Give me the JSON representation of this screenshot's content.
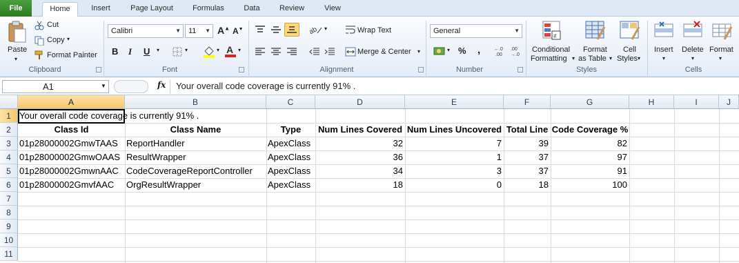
{
  "ribbon_tabs": [
    "File",
    "Home",
    "Insert",
    "Page Layout",
    "Formulas",
    "Data",
    "Review",
    "View"
  ],
  "clipboard": {
    "paste": "Paste",
    "cut": "Cut",
    "copy": "Copy",
    "format_painter": "Format Painter",
    "label": "Clipboard"
  },
  "font": {
    "name": "Calibri",
    "size": "11",
    "bold": "B",
    "italic": "I",
    "underline": "U",
    "label": "Font"
  },
  "alignment": {
    "wrap_text": "Wrap Text",
    "merge_center": "Merge & Center",
    "label": "Alignment"
  },
  "number": {
    "format": "General",
    "percent": "%",
    "comma": ",",
    "label": "Number"
  },
  "styles": {
    "conditional": "Conditional",
    "formatting": "Formatting",
    "format": "Format",
    "as_table": "as Table",
    "cell": "Cell",
    "cell_styles": "Styles",
    "label": "Styles"
  },
  "cells": {
    "insert": "Insert",
    "delete": "Delete",
    "format": "Format",
    "label": "Cells"
  },
  "formula_bar": {
    "name_box": "A1",
    "fx": "fx",
    "content": "Your overall code coverage is currently 91% ."
  },
  "columns": [
    "A",
    "B",
    "C",
    "D",
    "E",
    "F",
    "G",
    "H",
    "I",
    "J"
  ],
  "rows": [
    "1",
    "2",
    "3",
    "4",
    "5",
    "6",
    "7",
    "8",
    "9",
    "10",
    "11"
  ],
  "sheet": {
    "a1": "Your overall code coverage is currently 91% .",
    "headers": [
      "Class Id",
      "Class Name",
      "Type",
      "Num Lines Covered",
      "Num Lines Uncovered",
      "Total Line",
      "Code Coverage %"
    ],
    "data": [
      [
        "01p28000002GmwTAAS",
        "ReportHandler",
        "ApexClass",
        "32",
        "7",
        "39",
        "82"
      ],
      [
        "01p28000002GmwOAAS",
        "ResultWrapper",
        "ApexClass",
        "36",
        "1",
        "37",
        "97"
      ],
      [
        "01p28000002GmwnAAC",
        "CodeCoverageReportController",
        "ApexClass",
        "34",
        "3",
        "37",
        "91"
      ],
      [
        "01p28000002GmvfAAC",
        "OrgResultWrapper",
        "ApexClass",
        "18",
        "0",
        "18",
        "100"
      ]
    ]
  }
}
